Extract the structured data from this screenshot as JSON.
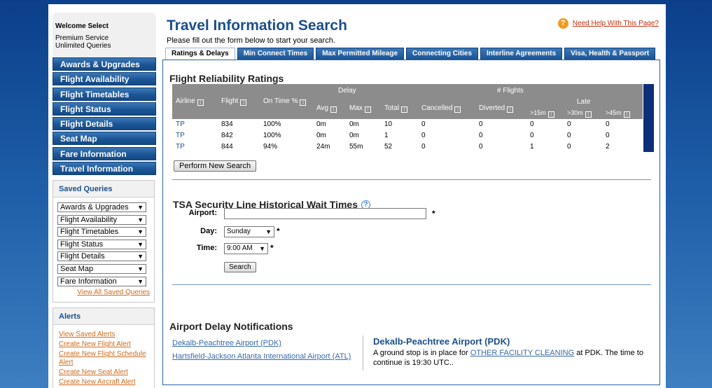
{
  "sidebar": {
    "welcome": "Welcome Select",
    "service_line1": "Premium Service",
    "service_line2": "Unlimited Queries",
    "nav": [
      "Awards & Upgrades",
      "Flight Availability",
      "Flight Timetables",
      "Flight Status",
      "Flight Details",
      "Seat Map",
      "Fare Information",
      "Travel Information"
    ],
    "saved_title": "Saved Queries",
    "saved_queries": [
      "Awards & Upgrades",
      "Flight Availability",
      "Flight Timetables",
      "Flight Status",
      "Flight Details",
      "Seat Map",
      "Fare Information"
    ],
    "view_all": "View All Saved Queries",
    "alerts_title": "Alerts",
    "alerts": [
      "View Saved Alerts",
      "Create New Flight Alert",
      "Create New Flight Schedule Alert",
      "Create New Seat Alert",
      "Create New Aircraft Alert"
    ]
  },
  "header": {
    "title": "Travel Information Search",
    "subtitle": "Please fill out the form below to start your search.",
    "help": "Need Help With This Page?"
  },
  "tabs": [
    "Ratings & Delays",
    "Min Connect Times",
    "Max Permitted Mileage",
    "Connecting Cities",
    "Interline Agreements",
    "Visa, Health & Passport"
  ],
  "ratings": {
    "heading": "Flight Reliability Ratings",
    "h_airline": "Airline",
    "h_flight": "Flight",
    "h_ontime": "On Time %",
    "h_delay": "Delay",
    "h_avg": "Avg",
    "h_max": "Max",
    "h_total": "Total",
    "h_cancelled": "Cancelled",
    "h_flights": "# Flights",
    "h_diverted": "Diverted",
    "h_late": "Late",
    "h_15": ">15m",
    "h_30": ">30m",
    "h_45": ">45m",
    "rows": [
      {
        "airline": "TP",
        "flight": "834",
        "ontime": "100%",
        "avg": "0m",
        "max": "0m",
        "total": "10",
        "cancelled": "0",
        "diverted": "0",
        "l15": "0",
        "l30": "0",
        "l45": "0"
      },
      {
        "airline": "TP",
        "flight": "842",
        "ontime": "100%",
        "avg": "0m",
        "max": "0m",
        "total": "1",
        "cancelled": "0",
        "diverted": "0",
        "l15": "0",
        "l30": "0",
        "l45": "0"
      },
      {
        "airline": "TP",
        "flight": "844",
        "ontime": "94%",
        "avg": "24m",
        "max": "55m",
        "total": "52",
        "cancelled": "0",
        "diverted": "0",
        "l15": "1",
        "l30": "0",
        "l45": "2"
      }
    ],
    "new_search": "Perform New Search"
  },
  "tsa": {
    "heading": "TSA Security Line Historical Wait Times",
    "airport_label": "Airport:",
    "airport_value": "",
    "day_label": "Day:",
    "day_value": "Sunday",
    "time_label": "Time:",
    "time_value": "9:00 AM",
    "required": "*",
    "search": "Search"
  },
  "delays": {
    "heading": "Airport Delay Notifications",
    "airports": [
      "Dekalb-Peachtree Airport (PDK)",
      "Hartsfield-Jackson Atlanta International Airport (ATL)"
    ],
    "detail_name": "Dekalb-Peachtree Airport (PDK)",
    "msg_pre": "A ground stop is in place for ",
    "msg_link": "OTHER FACILITY CLEANING",
    "msg_post": " at PDK. The time to continue is 19:30 UTC.."
  }
}
